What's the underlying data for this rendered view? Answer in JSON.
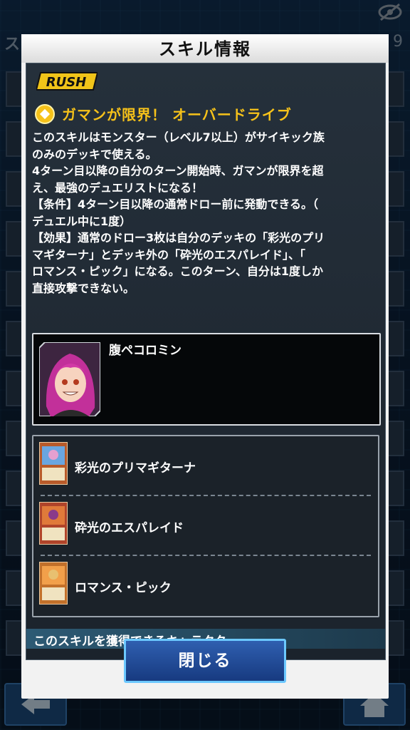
{
  "background": {
    "title": "スキル一覧",
    "count": "9"
  },
  "dialog": {
    "title": "スキル情報",
    "badge": "RUSH",
    "skill": {
      "name": "ガマンが限界！ オーバードライブ",
      "description": "このスキルはモンスター（レベル7以上）がサイキック族\nのみのデッキで使える。\n4ターン目以降の自分のターン開始時、ガマンが限界を超\nえ、最強のデュエリストになる！\n【条件】4ターン目以降の通常ドロー前に発動できる。（\nデュエル中に1度）\n【効果】通常のドロー3枚は自分のデッキの「彩光のプリ\nマギターナ」とデッキ外の「砕光のエスパレイド」、「\nロマンス・ピック」になる。このターン、自分は1度しか\n直接攻撃できない。"
    },
    "character": {
      "name": "腹ペコロミン"
    },
    "cards": [
      {
        "name": "彩光のプリマギターナ"
      },
      {
        "name": "砕光のエスパレイド"
      },
      {
        "name": "ロマンス・ピック"
      }
    ],
    "acquire_label": "このスキルを獲得できるキャラクター",
    "close_label": "閉じる"
  },
  "colors": {
    "accent": "#f6c21a",
    "panel": "#1f2830",
    "button": "#1f4a9a"
  }
}
